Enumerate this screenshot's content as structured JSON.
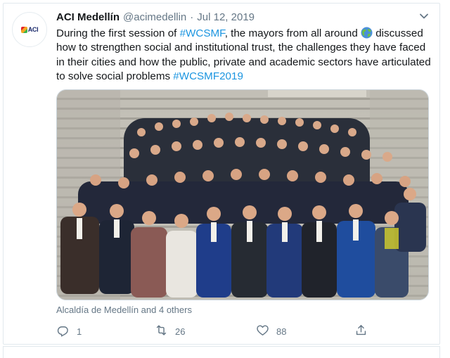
{
  "tweet": {
    "display_name": "ACI Medellín",
    "handle": "@acimedellin",
    "separator": "·",
    "date": "Jul 12, 2019",
    "avatar_logo_text": "ACI",
    "text_parts": {
      "p1": "During the first session of ",
      "h1": "#WCSMF",
      "p2": ", the mayors from all around ",
      "p3": " discussed how to strengthen social and institutional trust, the challenges they have faced in their cities and how the public, private and academic sectors have articulated to solve social problems ",
      "h2": "#WCSMF2019"
    },
    "tagged": "Alcaldía de Medellín and 4 others",
    "actions": {
      "replies": "1",
      "retweets": "26",
      "likes": "88"
    }
  },
  "icons": {
    "more": "chevron-down-icon",
    "globe": "globe-emoji-icon",
    "reply": "reply-icon",
    "retweet": "retweet-icon",
    "like": "heart-icon",
    "share": "share-icon"
  },
  "colors": {
    "hashtag": "#1b95e0",
    "muted": "#657786",
    "text": "#14171a",
    "border": "#e1e8ed"
  }
}
